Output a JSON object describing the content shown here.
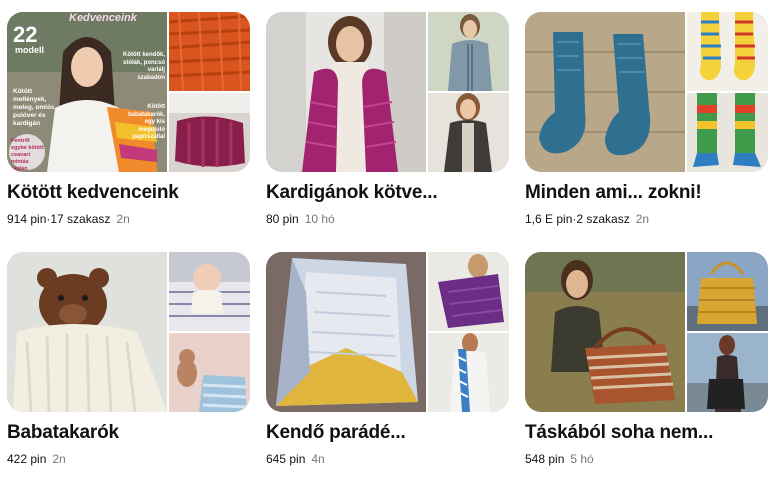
{
  "boards": [
    {
      "title": "Kötött kedvenceink",
      "pins": "914 pin",
      "sections": "17 szakasz",
      "age": "2n",
      "cover": {
        "magazine_name": "Kedvenceink",
        "number": "22",
        "subtitle": "modell",
        "blurb_left": "Kötött mellények, meleg, omlós pulóver és kardigán",
        "blurb_right": "Kötött kendők, stólák, poncsó variálj szabadon",
        "blurb_right2": "Kötött babatakarók, egy kis megújuló papírszállal",
        "badge": "Fentről egybe kötött csavart mintás raglán pulóver"
      }
    },
    {
      "title": "Kardigánok kötve...",
      "pins": "80 pin",
      "age": "10 hó"
    },
    {
      "title": "Minden ami... zokni!",
      "pins": "1,6 E pin",
      "sections": "2 szakasz",
      "age": "2n"
    },
    {
      "title": "Babatakarók",
      "pins": "422 pin",
      "age": "2n"
    },
    {
      "title": "Kendő parádé...",
      "pins": "645 pin",
      "age": "4n"
    },
    {
      "title": "Táskából soha nem...",
      "pins": "548 pin",
      "age": "5 hó"
    }
  ],
  "separator": " · "
}
